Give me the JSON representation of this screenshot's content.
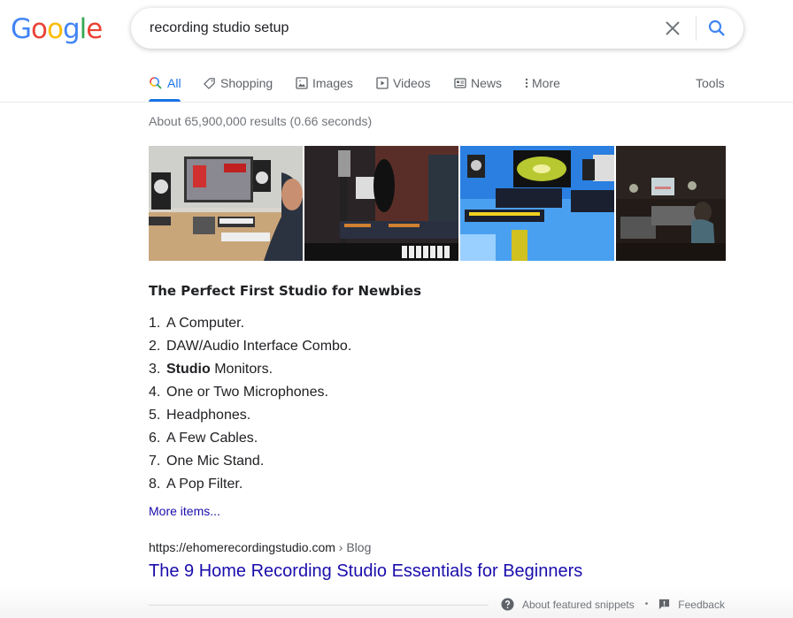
{
  "logo": {
    "letters": [
      "G",
      "o",
      "o",
      "g",
      "l",
      "e"
    ],
    "colors": [
      "#4285f4",
      "#ea4335",
      "#fbbc05",
      "#4285f4",
      "#34a853",
      "#ea4335"
    ]
  },
  "search": {
    "query": "recording studio setup",
    "clear_icon": "close-icon",
    "submit_icon": "search-icon"
  },
  "tabs": [
    {
      "label": "All",
      "icon": "search-icon",
      "active": true
    },
    {
      "label": "Shopping",
      "icon": "tag-icon"
    },
    {
      "label": "Images",
      "icon": "image-icon"
    },
    {
      "label": "Videos",
      "icon": "play-icon"
    },
    {
      "label": "News",
      "icon": "newspaper-icon"
    },
    {
      "label": "More",
      "icon": "vertical-dots-icon"
    }
  ],
  "tools_label": "Tools",
  "result_stats": "About 65,900,000 results (0.66 seconds)",
  "images": [
    {
      "alt": "Home studio desk with monitor, speakers and MIDI keyboard"
    },
    {
      "alt": "Condenser microphone with pop filter in dark studio"
    },
    {
      "alt": "Blue-lit studio desk with keyboard and monitors"
    },
    {
      "alt": "Person at mixing console in dark studio"
    }
  ],
  "snippet": {
    "title": "The Perfect First Studio for Newbies",
    "items": [
      {
        "num": "1.",
        "bold": "",
        "text": "A Computer."
      },
      {
        "num": "2.",
        "bold": "",
        "text": "DAW/Audio Interface Combo."
      },
      {
        "num": "3.",
        "bold": "Studio",
        "text": " Monitors."
      },
      {
        "num": "4.",
        "bold": "",
        "text": "One or Two Microphones."
      },
      {
        "num": "5.",
        "bold": "",
        "text": "Headphones."
      },
      {
        "num": "6.",
        "bold": "",
        "text": "A Few Cables."
      },
      {
        "num": "7.",
        "bold": "",
        "text": "One Mic Stand."
      },
      {
        "num": "8.",
        "bold": "",
        "text": "A Pop Filter."
      }
    ],
    "more_items": "More items..."
  },
  "result": {
    "url": "https://ehomerecordingstudio.com",
    "breadcrumb": " › Blog",
    "title": "The 9 Home Recording Studio Essentials for Beginners"
  },
  "footer": {
    "about": "About featured snippets",
    "separator": "•",
    "feedback": "Feedback"
  },
  "colors": {
    "accent": "#1a73e8",
    "link": "#1a0dab",
    "muted": "#70757a"
  }
}
